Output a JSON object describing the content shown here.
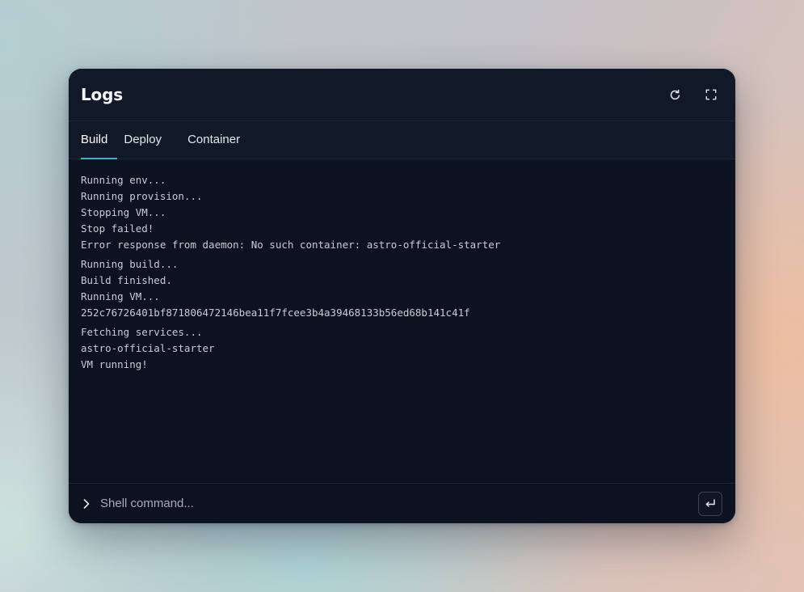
{
  "header": {
    "title": "Logs",
    "refresh_icon": "refresh-icon",
    "fullscreen_icon": "expand-icon"
  },
  "tabs": [
    {
      "label": "Build",
      "active": true
    },
    {
      "label": "Deploy",
      "active": false
    },
    {
      "label": "Container",
      "active": false
    }
  ],
  "log_groups": [
    {
      "lines": [
        "Running env...",
        "Running provision...",
        "Stopping VM...",
        "Stop failed!",
        "Error response from daemon: No such container: astro-official-starter"
      ]
    },
    {
      "lines": [
        "Running build...",
        "Build finished.",
        "Running VM...",
        "252c76726401bf871806472146bea11f7fcee3b4a39468133b56ed68b141c41f"
      ]
    },
    {
      "lines": [
        "Fetching services...",
        "astro-official-starter",
        "VM running!"
      ]
    }
  ],
  "shell": {
    "placeholder": "Shell command...",
    "value": "",
    "prompt_icon": "chevron-right-icon",
    "submit_icon": "enter-icon"
  },
  "colors": {
    "window_bg": "#0c1220",
    "header_bg": "#111828",
    "active_tab_underline": "#38b2c8",
    "log_text": "#c8ccd4"
  }
}
